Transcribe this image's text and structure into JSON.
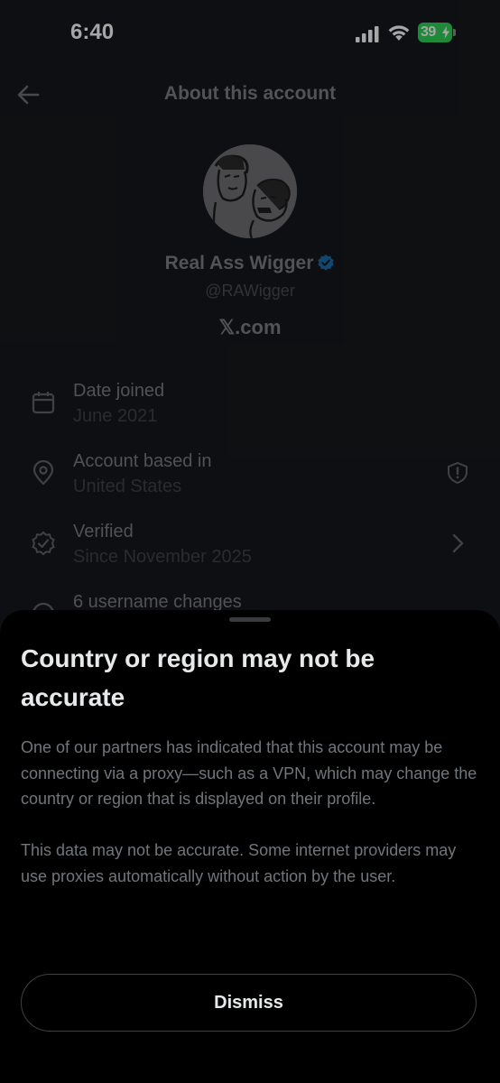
{
  "status_bar": {
    "time": "6:40",
    "battery_level": "39",
    "battery_color": "#30d158"
  },
  "header": {
    "title": "About this account",
    "back_icon": "arrow-left-icon"
  },
  "profile": {
    "display_name": "Real Ass Wigger",
    "handle": "@RAWigger",
    "site": "𝕏.com",
    "verified_color": "#1d9bf0"
  },
  "details": [
    {
      "icon": "calendar-icon",
      "label": "Date joined",
      "value": "June 2021"
    },
    {
      "icon": "location-pin-icon",
      "label": "Account based in",
      "value": "United States",
      "end_icon": "shield-alert-icon"
    },
    {
      "icon": "verified-seal-icon",
      "label": "Verified",
      "value": "Since November 2025",
      "end_icon": "chevron-right-icon"
    },
    {
      "icon": "history-icon",
      "label": "6 username changes"
    }
  ],
  "sheet": {
    "title": "Country or region may not be accurate",
    "paragraphs": [
      "One of our partners has indicated that this account may be connecting via a proxy—such as a VPN, which may change the country or region that is displayed on their profile.",
      "This data may not be accurate. Some internet providers may use proxies automatically without action by the user."
    ],
    "dismiss_label": "Dismiss"
  }
}
